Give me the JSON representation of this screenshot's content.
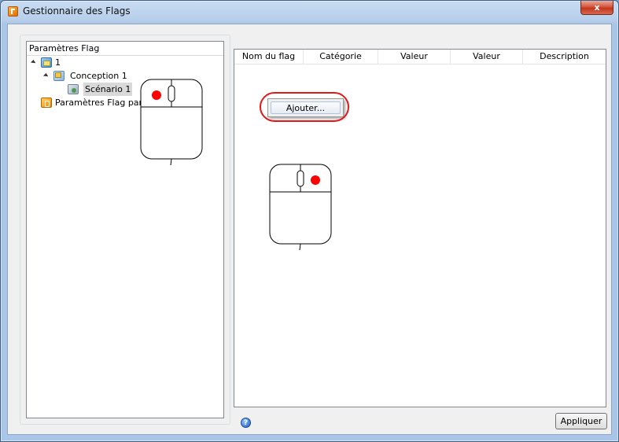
{
  "window": {
    "title": "Gestionnaire des Flags",
    "close_label": "x"
  },
  "tree": {
    "header": "Paramètres Flag",
    "items": [
      {
        "label": "1",
        "icon": "project-icon",
        "level": 0,
        "expanded": true
      },
      {
        "label": "Conception 1",
        "icon": "design-icon",
        "level": 1,
        "expanded": true
      },
      {
        "label": "Scénario 1",
        "icon": "scenario-icon",
        "level": 2,
        "selected": true
      },
      {
        "label": "Paramètres Flag par dé",
        "icon": "default-flag-icon",
        "level": 0
      }
    ]
  },
  "flag_list": {
    "columns": [
      "Nom du flag",
      "Catégorie",
      "Valeur",
      "Valeur",
      "Description"
    ]
  },
  "context_menu": {
    "items": [
      "Ajouter..."
    ]
  },
  "footer": {
    "help_label": "?",
    "apply_label": "Appliquer"
  },
  "colors": {
    "highlight": "#e01818",
    "mouse_button": "#ff0000",
    "selection": "#d9d9d9"
  }
}
